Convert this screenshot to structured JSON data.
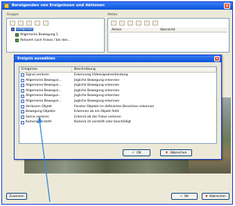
{
  "window": {
    "title": "Bereigenden von Ereignissen und Aktionen"
  },
  "groups": {
    "left_label": "Gruppe",
    "right_label": "Aktion"
  },
  "tree": {
    "items": [
      {
        "label": "Ereignisse",
        "selected": true
      },
      {
        "label": "Allgemeine Bewegung 1"
      },
      {
        "label": "Aktiviert nach Anlass / bei den..."
      }
    ]
  },
  "right_table": {
    "headers": [
      "Aktion",
      "Ubersicht"
    ]
  },
  "dialog": {
    "title": "Ereignis auswählen",
    "columns": [
      "Ereignisse",
      "Beschreibung"
    ],
    "rows": [
      {
        "name": "Signal verloren",
        "desc": "Erkennung Videosignalverbindung"
      },
      {
        "name": "Allgemeine Bewegun...",
        "desc": "Jegliche Bewegung erkennen"
      },
      {
        "name": "Allgemeine Bewegun...",
        "desc": "Jegliche Bewegung erkennen"
      },
      {
        "name": "Allgemeine Bewegun...",
        "desc": "Jegliche Bewegung erkennen"
      },
      {
        "name": "Allgemeine Bewegun...",
        "desc": "Jegliche Bewegung erkennen"
      },
      {
        "name": "Allgemeine Bewegun...",
        "desc": "Jegliche Bewegung erkennen"
      },
      {
        "name": "Verlassen Objekt",
        "desc": "Fenster Objekte im definierten Bereichen erkennen"
      },
      {
        "name": "Bewegung Objekte",
        "desc": "Erkennen ob ein Objekt fehlt"
      },
      {
        "name": "Szene verloren",
        "desc": "Erkennt ob der Fokus verloren"
      },
      {
        "name": "Kamera verstellt",
        "desc": "Kamera ist verstellt oder beschädigt"
      }
    ],
    "ok_label": "OK",
    "cancel_label": "Abbrechen"
  },
  "bottom": {
    "left_label": "Zuweisen",
    "ok_label": "OK",
    "cancel_label": "Abbrechen"
  },
  "colors": {
    "titlebar": "#0a53d9",
    "selection": "#316ac5",
    "face": "#ece9d8",
    "arrow": "#3a8ad4"
  }
}
